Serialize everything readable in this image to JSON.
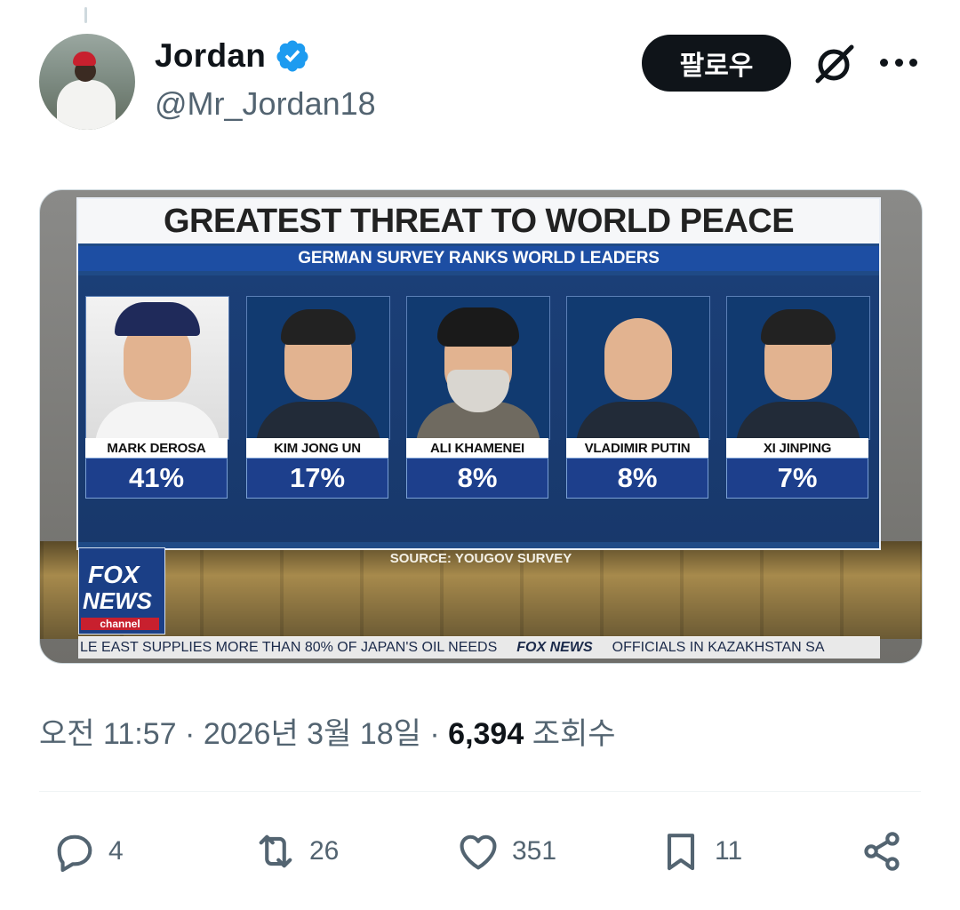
{
  "tweet": {
    "author": {
      "display_name": "Jordan",
      "handle": "@Mr_Jordan18",
      "verified": true
    },
    "follow_label": "팔로우",
    "icons": {
      "verified": "verified-badge-icon",
      "grok": "grok-icon",
      "more": "more-icon"
    },
    "media": {
      "title": "GREATEST THREAT TO WORLD PEACE",
      "subtitle": "GERMAN SURVEY RANKS WORLD LEADERS",
      "leaders": [
        {
          "name": "MARK DEROSA",
          "percent": "41%"
        },
        {
          "name": "KIM JONG UN",
          "percent": "17%"
        },
        {
          "name": "ALI KHAMENEI",
          "percent": "8%"
        },
        {
          "name": "VLADIMIR PUTIN",
          "percent": "8%"
        },
        {
          "name": "XI JINPING",
          "percent": "7%"
        }
      ],
      "source": "SOURCE: YOUGOV SURVEY",
      "logo": {
        "line1": "FOX",
        "line2": "NEWS",
        "line3": "channel"
      },
      "ticker": {
        "left": "LE EAST SUPPLIES MORE THAN 80% OF JAPAN'S OIL NEEDS",
        "brand": "FOX NEWS",
        "right": "OFFICIALS IN KAZAKHSTAN SA"
      }
    },
    "meta": {
      "time": "오전 11:57",
      "date": "2026년 3월 18일",
      "separator": "·",
      "views_count": "6,394",
      "views_label": "조회수"
    },
    "actions": {
      "reply": "4",
      "retweet": "26",
      "like": "351",
      "bookmark": "11"
    },
    "colors": {
      "follow_bg": "#0f1419",
      "verified_blue": "#1d9bf0",
      "secondary_text": "#536471"
    }
  }
}
